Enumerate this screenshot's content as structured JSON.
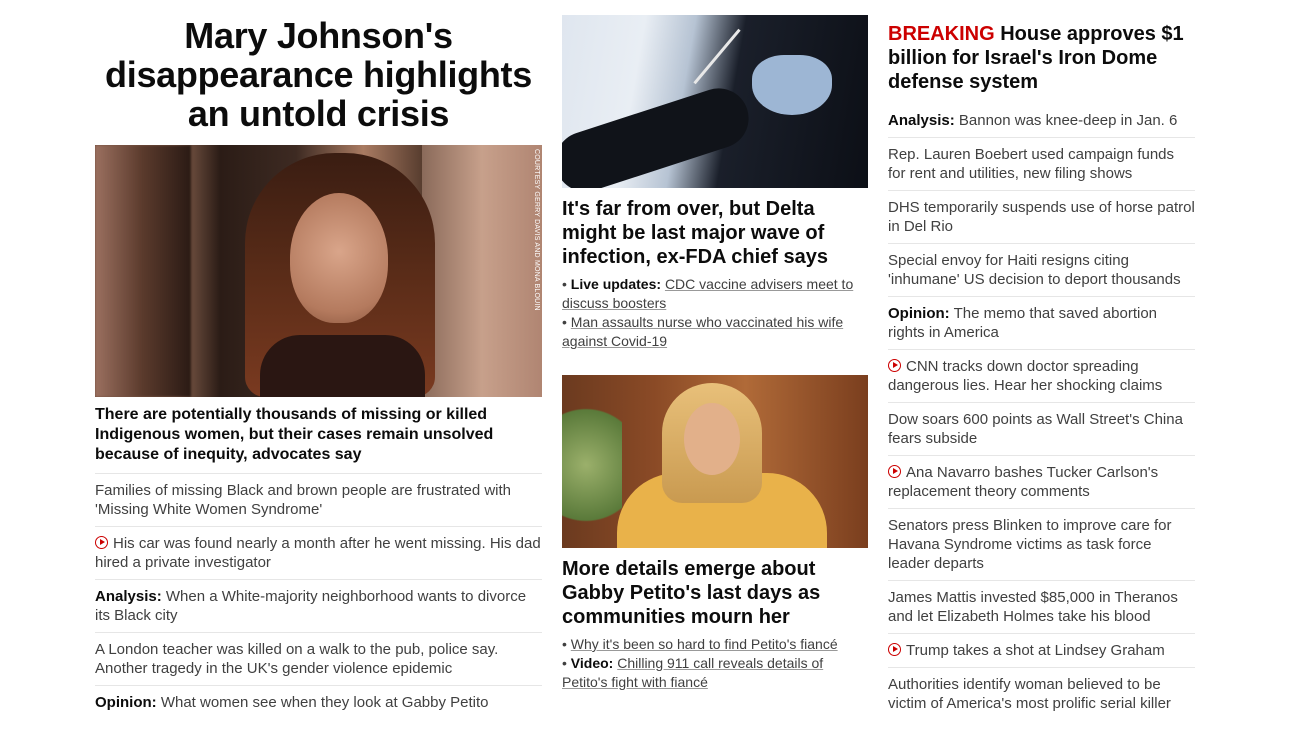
{
  "col1": {
    "headline": "Mary Johnson's disappearance highlights an untold crisis",
    "photo_credit": "COURTESY GERRY DAVIS AND MONA BLOUIN",
    "subhead": "There are potentially thousands of missing or killed Indigenous women, but their cases remain unsolved because of inequity, advocates say",
    "items": [
      {
        "label": "",
        "text": "Families of missing Black and brown people are frustrated with 'Missing White Women Syndrome'",
        "video": false
      },
      {
        "label": "",
        "text": "His car was found nearly a month after he went missing. His dad hired a private investigator",
        "video": true
      },
      {
        "label": "Analysis:",
        "text": "When a White-majority neighborhood wants to divorce its Black city",
        "video": false
      },
      {
        "label": "",
        "text": "A London teacher was killed on a walk to the pub, police say. Another tragedy in the UK's gender violence epidemic",
        "video": false
      },
      {
        "label": "Opinion:",
        "text": "What women see when they look at Gabby Petito",
        "video": false
      }
    ]
  },
  "col2": {
    "story1": {
      "headline": "It's far from over, but Delta might be last major wave of infection, ex-FDA chief says",
      "bullets": [
        {
          "label": "Live updates:",
          "text": "CDC vaccine advisers meet to discuss boosters"
        },
        {
          "label": "",
          "text": "Man assaults nurse who vaccinated his wife against Covid-19"
        }
      ]
    },
    "story2": {
      "headline": "More details emerge about Gabby Petito's last days as communities mourn her",
      "bullets": [
        {
          "label": "",
          "text": "Why it's been so hard to find Petito's fiancé"
        },
        {
          "label": "Video:",
          "text": "Chilling 911 call reveals details of Petito's fight with fiancé"
        }
      ]
    }
  },
  "col3": {
    "breaking_label": "BREAKING",
    "breaking_text": "House approves $1 billion for Israel's Iron Dome defense system",
    "items": [
      {
        "label": "Analysis:",
        "text": "Bannon was knee-deep in Jan. 6",
        "video": false
      },
      {
        "label": "",
        "text": "Rep. Lauren Boebert used campaign funds for rent and utilities, new filing shows",
        "video": false
      },
      {
        "label": "",
        "text": "DHS temporarily suspends use of horse patrol in Del Rio",
        "video": false
      },
      {
        "label": "",
        "text": "Special envoy for Haiti resigns citing 'inhumane' US decision to deport thousands",
        "video": false
      },
      {
        "label": "Opinion:",
        "text": "The memo that saved abortion rights in America",
        "video": false
      },
      {
        "label": "",
        "text": "CNN tracks down doctor spreading dangerous lies. Hear her shocking claims",
        "video": true
      },
      {
        "label": "",
        "text": "Dow soars 600 points as Wall Street's China fears subside",
        "video": false
      },
      {
        "label": "",
        "text": "Ana Navarro bashes Tucker Carlson's replacement theory comments",
        "video": true
      },
      {
        "label": "",
        "text": "Senators press Blinken to improve care for Havana Syndrome victims as task force leader departs",
        "video": false
      },
      {
        "label": "",
        "text": "James Mattis invested $85,000 in Theranos and let Elizabeth Holmes take his blood",
        "video": false
      },
      {
        "label": "",
        "text": "Trump takes a shot at Lindsey Graham",
        "video": true
      },
      {
        "label": "",
        "text": "Authorities identify woman believed to be victim of America's most prolific serial killer",
        "video": false
      }
    ]
  },
  "colors": {
    "breaking": "#cc0000",
    "video_icon": "#cc0000",
    "headline": "#0c0c0c",
    "body": "#404040",
    "divider": "#e6e6e6"
  },
  "icons": {
    "video": "play-circle-icon"
  }
}
